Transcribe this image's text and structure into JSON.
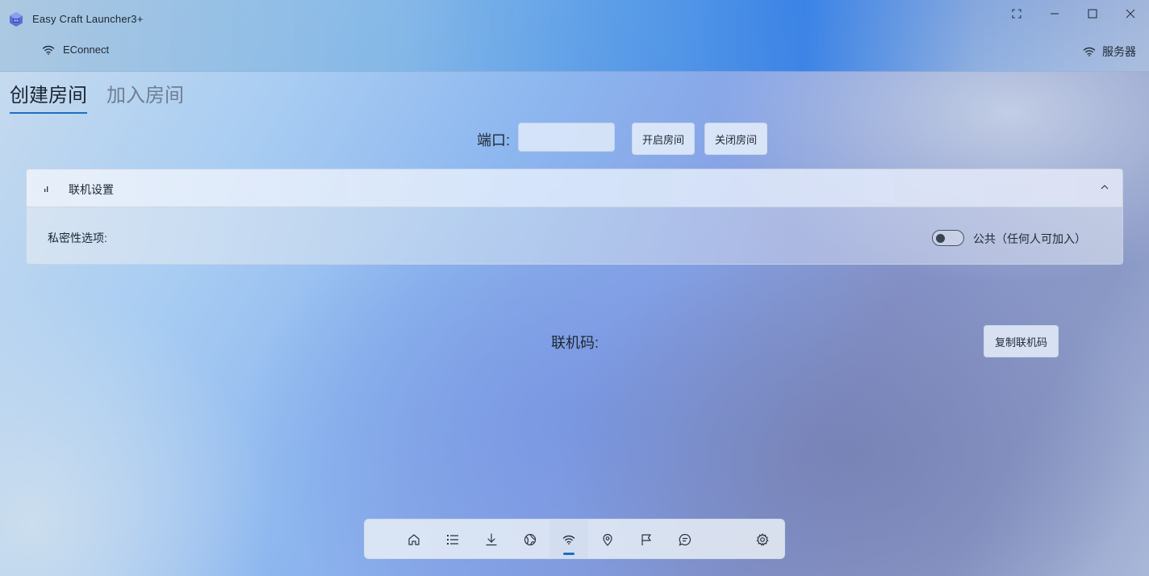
{
  "window": {
    "title": "Easy Craft Launcher3+",
    "controls": [
      "fullscreen-icon",
      "minimize-icon",
      "maximize-icon",
      "close-icon"
    ]
  },
  "header": {
    "left_item": {
      "label": "EConnect",
      "icon": "wifi-icon"
    },
    "right_item": {
      "label": "服务器",
      "icon": "wifi-icon"
    }
  },
  "tabs": [
    {
      "label": "创建房间",
      "active": true
    },
    {
      "label": "加入房间",
      "active": false
    }
  ],
  "port": {
    "label": "端口:",
    "value": "",
    "open_button": "开启房间",
    "close_button": "关闭房间"
  },
  "settings_panel": {
    "title": "联机设置",
    "icon": "signal-icon",
    "expanded": true,
    "privacy_label": "私密性选项:",
    "toggle_label": "公共（任何人可加入）",
    "toggle_on": false
  },
  "link_code": {
    "label": "联机码:",
    "copy_button": "复制联机码"
  },
  "bottom_nav": {
    "items": [
      {
        "icon": "home-icon"
      },
      {
        "icon": "list-icon"
      },
      {
        "icon": "download-icon"
      },
      {
        "icon": "globe-icon"
      },
      {
        "icon": "wifi-icon",
        "active": true
      },
      {
        "icon": "location-icon"
      },
      {
        "icon": "flag-icon"
      },
      {
        "icon": "chat-icon"
      },
      {
        "icon": "settings-icon"
      }
    ]
  },
  "colors": {
    "accent": "#1e6fbf",
    "title_band": "#2d7de6"
  }
}
